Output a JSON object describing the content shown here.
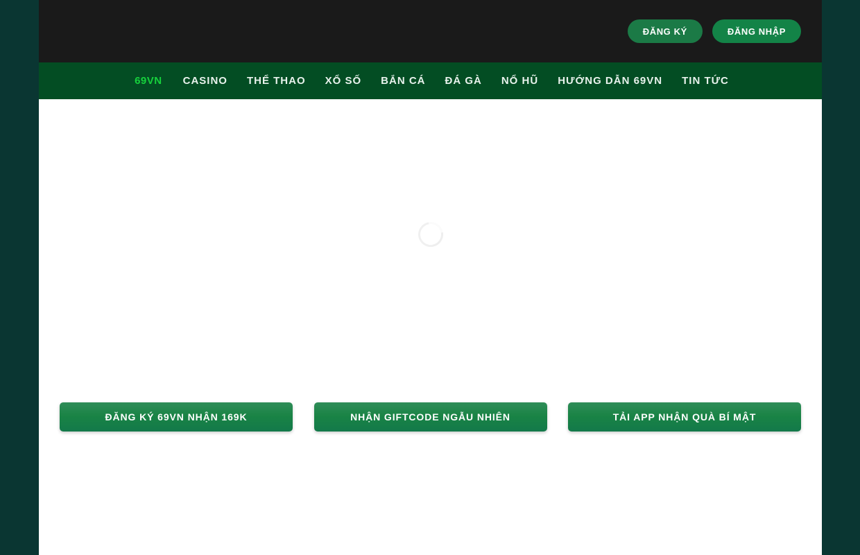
{
  "site": {
    "background_color": "#0a3632",
    "topbar_color": "#1a1a1a",
    "nav_color": "#034d23",
    "brand_accent": "#16d13c",
    "button_green": "#198345"
  },
  "topbar": {
    "register_label": "ĐĂNG KÝ",
    "login_label": "ĐĂNG NHẬP"
  },
  "nav": {
    "items": [
      {
        "label": "69VN",
        "brand": true
      },
      {
        "label": "CASINO",
        "brand": false
      },
      {
        "label": "THỂ THAO",
        "brand": false
      },
      {
        "label": "XỔ SỐ",
        "brand": false
      },
      {
        "label": "BẮN CÁ",
        "brand": false
      },
      {
        "label": "ĐÁ GÀ",
        "brand": false
      },
      {
        "label": "NỔ HŨ",
        "brand": false
      },
      {
        "label": "HƯỚNG DẪN 69VN",
        "brand": false
      },
      {
        "label": "TIN TỨC",
        "brand": false
      }
    ]
  },
  "main": {
    "loading_state": "loading",
    "cta_buttons": [
      {
        "label": "ĐĂNG KÝ 69VN NHẬN 169K"
      },
      {
        "label": "NHẬN GIFTCODE NGẪU NHIÊN"
      },
      {
        "label": "TẢI APP NHẬN QUÀ BÍ MẬT"
      }
    ]
  }
}
